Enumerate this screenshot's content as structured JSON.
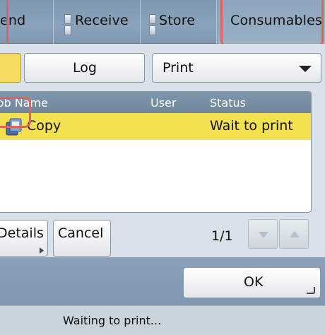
{
  "tabs": [
    {
      "label": "end"
    },
    {
      "label": "Receive"
    },
    {
      "label": "Store"
    },
    {
      "label": "Consumables"
    }
  ],
  "toolbar": {
    "log_label": "Log",
    "print_select_value": "Print"
  },
  "job_list": {
    "columns": [
      "Job Name",
      "User",
      "Status"
    ],
    "rows": [
      {
        "job_name": "Copy",
        "user": "",
        "status": "Wait to print"
      }
    ]
  },
  "actions": {
    "details_label": "Details",
    "cancel_label": "Cancel",
    "page_indicator": "1/1"
  },
  "ok_label": "OK",
  "status_text": "Waiting to print...",
  "colors": {
    "selected_row": "#f4e150",
    "callout": "#e0635a"
  }
}
